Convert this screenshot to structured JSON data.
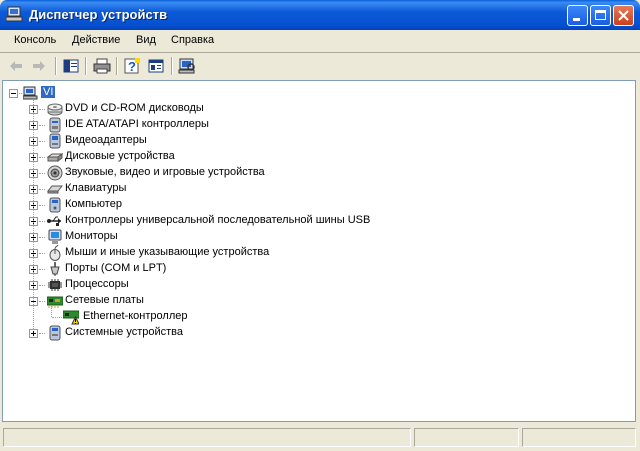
{
  "window": {
    "title": "Диспетчер устройств"
  },
  "menu": {
    "items": [
      {
        "label": "Консоль",
        "accel": "К"
      },
      {
        "label": "Действие",
        "accel": "Д"
      },
      {
        "label": "Вид",
        "accel": "В"
      },
      {
        "label": "Справка",
        "accel": "С"
      }
    ]
  },
  "toolbar": {
    "buttons": [
      "back-arrow-icon",
      "forward-arrow-icon",
      "show-hide-tree-icon",
      "print-icon",
      "help-icon",
      "properties-icon",
      "scan-hardware-icon"
    ]
  },
  "tree": {
    "root": {
      "label": "VI"
    },
    "categories": [
      {
        "label": "DVD и CD-ROM дисководы",
        "icon": "cdrom-icon",
        "expanded": false
      },
      {
        "label": "IDE ATA/ATAPI контроллеры",
        "icon": "ide-controller-icon",
        "expanded": false
      },
      {
        "label": "Видеоадаптеры",
        "icon": "display-adapter-icon",
        "expanded": false
      },
      {
        "label": "Дисковые устройства",
        "icon": "disk-drive-icon",
        "expanded": false
      },
      {
        "label": "Звуковые, видео и игровые устройства",
        "icon": "sound-icon",
        "expanded": false
      },
      {
        "label": "Клавиатуры",
        "icon": "keyboard-icon",
        "expanded": false
      },
      {
        "label": "Компьютер",
        "icon": "computer-icon",
        "expanded": false
      },
      {
        "label": "Контроллеры универсальной последовательной шины USB",
        "icon": "usb-icon",
        "expanded": false
      },
      {
        "label": "Мониторы",
        "icon": "monitor-icon",
        "expanded": false
      },
      {
        "label": "Мыши и иные указывающие устройства",
        "icon": "mouse-icon",
        "expanded": false
      },
      {
        "label": "Порты (COM и LPT)",
        "icon": "port-icon",
        "expanded": false
      },
      {
        "label": "Процессоры",
        "icon": "processor-icon",
        "expanded": false
      },
      {
        "label": "Сетевые платы",
        "icon": "network-card-icon",
        "expanded": true,
        "children": [
          {
            "label": "Ethernet-контроллер",
            "icon": "warning-network-icon"
          }
        ]
      },
      {
        "label": "Системные устройства",
        "icon": "system-device-icon",
        "expanded": false
      }
    ]
  },
  "colors": {
    "titlebar": "#0550d0",
    "selection": "#316ac5",
    "warning": "#ffd800"
  }
}
